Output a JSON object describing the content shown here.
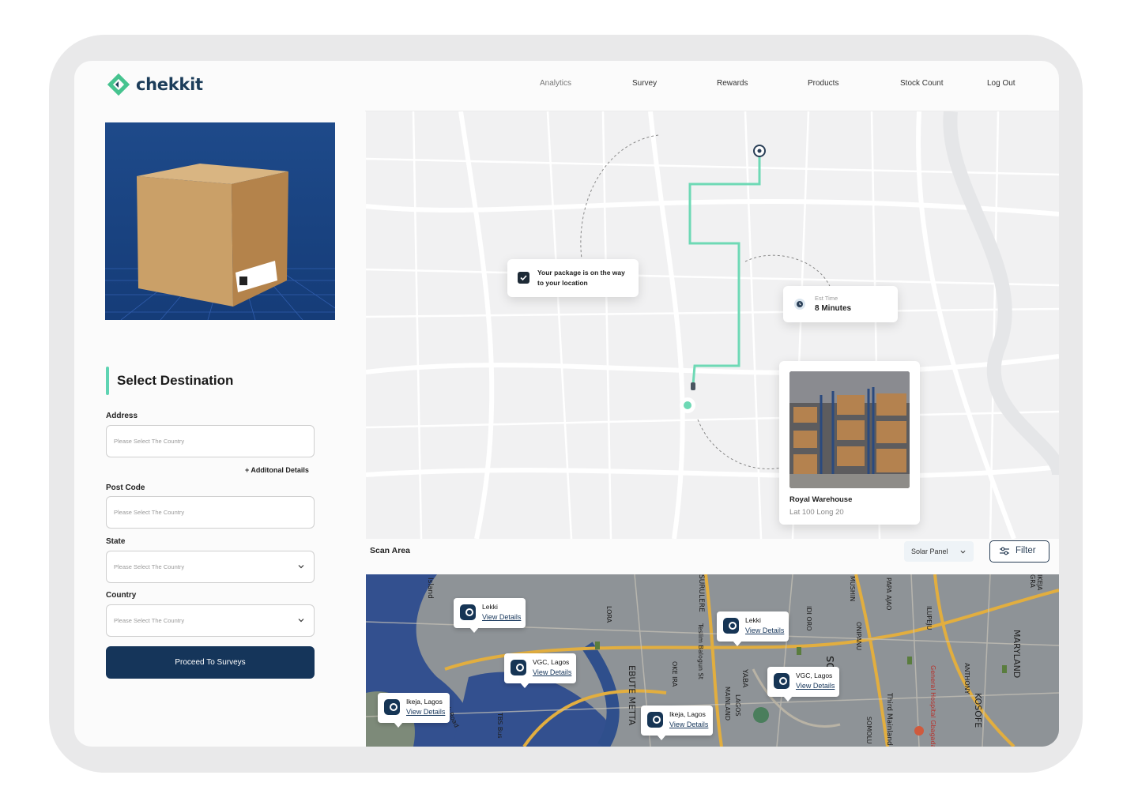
{
  "app": {
    "brand": "chekkit",
    "brand_color": "#46c38f",
    "primary_color": "#15355a"
  },
  "nav": {
    "items": [
      "Analytics",
      "Survey",
      "Rewards",
      "Products",
      "Stock Count",
      "Log Out"
    ]
  },
  "form": {
    "title": "Select Destination",
    "address_label": "Address",
    "address_placeholder": "Please Select The Country",
    "additional_details": "+ Additonal Details",
    "postcode_label": "Post Code",
    "postcode_placeholder": "Please Select The Country",
    "state_label": "State",
    "state_placeholder": "Please Select The Country",
    "country_label": "Country",
    "country_placeholder": "Please Select The Country",
    "proceed_label": "Proceed To Surveys"
  },
  "map": {
    "status_message": "Your package is on the way to your location",
    "est_time_label": "Est Time",
    "est_time_value": "8 Minutes",
    "warehouse_name": "Royal Warehouse",
    "warehouse_coords": "Lat 100 Long 20",
    "route_color": "#6ed9b5"
  },
  "scan": {
    "title": "Scan Area",
    "dropdown_value": "Solar Panel",
    "filter_label": "Filter",
    "view_details": "View Details",
    "pins": [
      {
        "name": "Lekki"
      },
      {
        "name": "Lekki"
      },
      {
        "name": "VGC, Lagos"
      },
      {
        "name": "VGC, Lagos"
      },
      {
        "name": "Ikeja, Lagos"
      },
      {
        "name": "Ikeja, Lagos"
      }
    ],
    "map_labels": [
      "Island",
      "Creek Road",
      "EBUTE METTA",
      "SURULERE",
      "Teslim Balogun St",
      "YABA",
      "MAINLAND",
      "LAGOS",
      "Lagos",
      "MUSHIN",
      "PAPA AJAO",
      "ILUPEJU",
      "ONIPANU",
      "SOMOLU",
      "Third Mainland",
      "General Hospital Gbagada",
      "ANTHONY",
      "KOSOFE",
      "MARYLAND",
      "IKEJA GRA",
      "TBS Bus",
      "OKE IRA",
      "IDI ORO",
      "LORA"
    ]
  }
}
